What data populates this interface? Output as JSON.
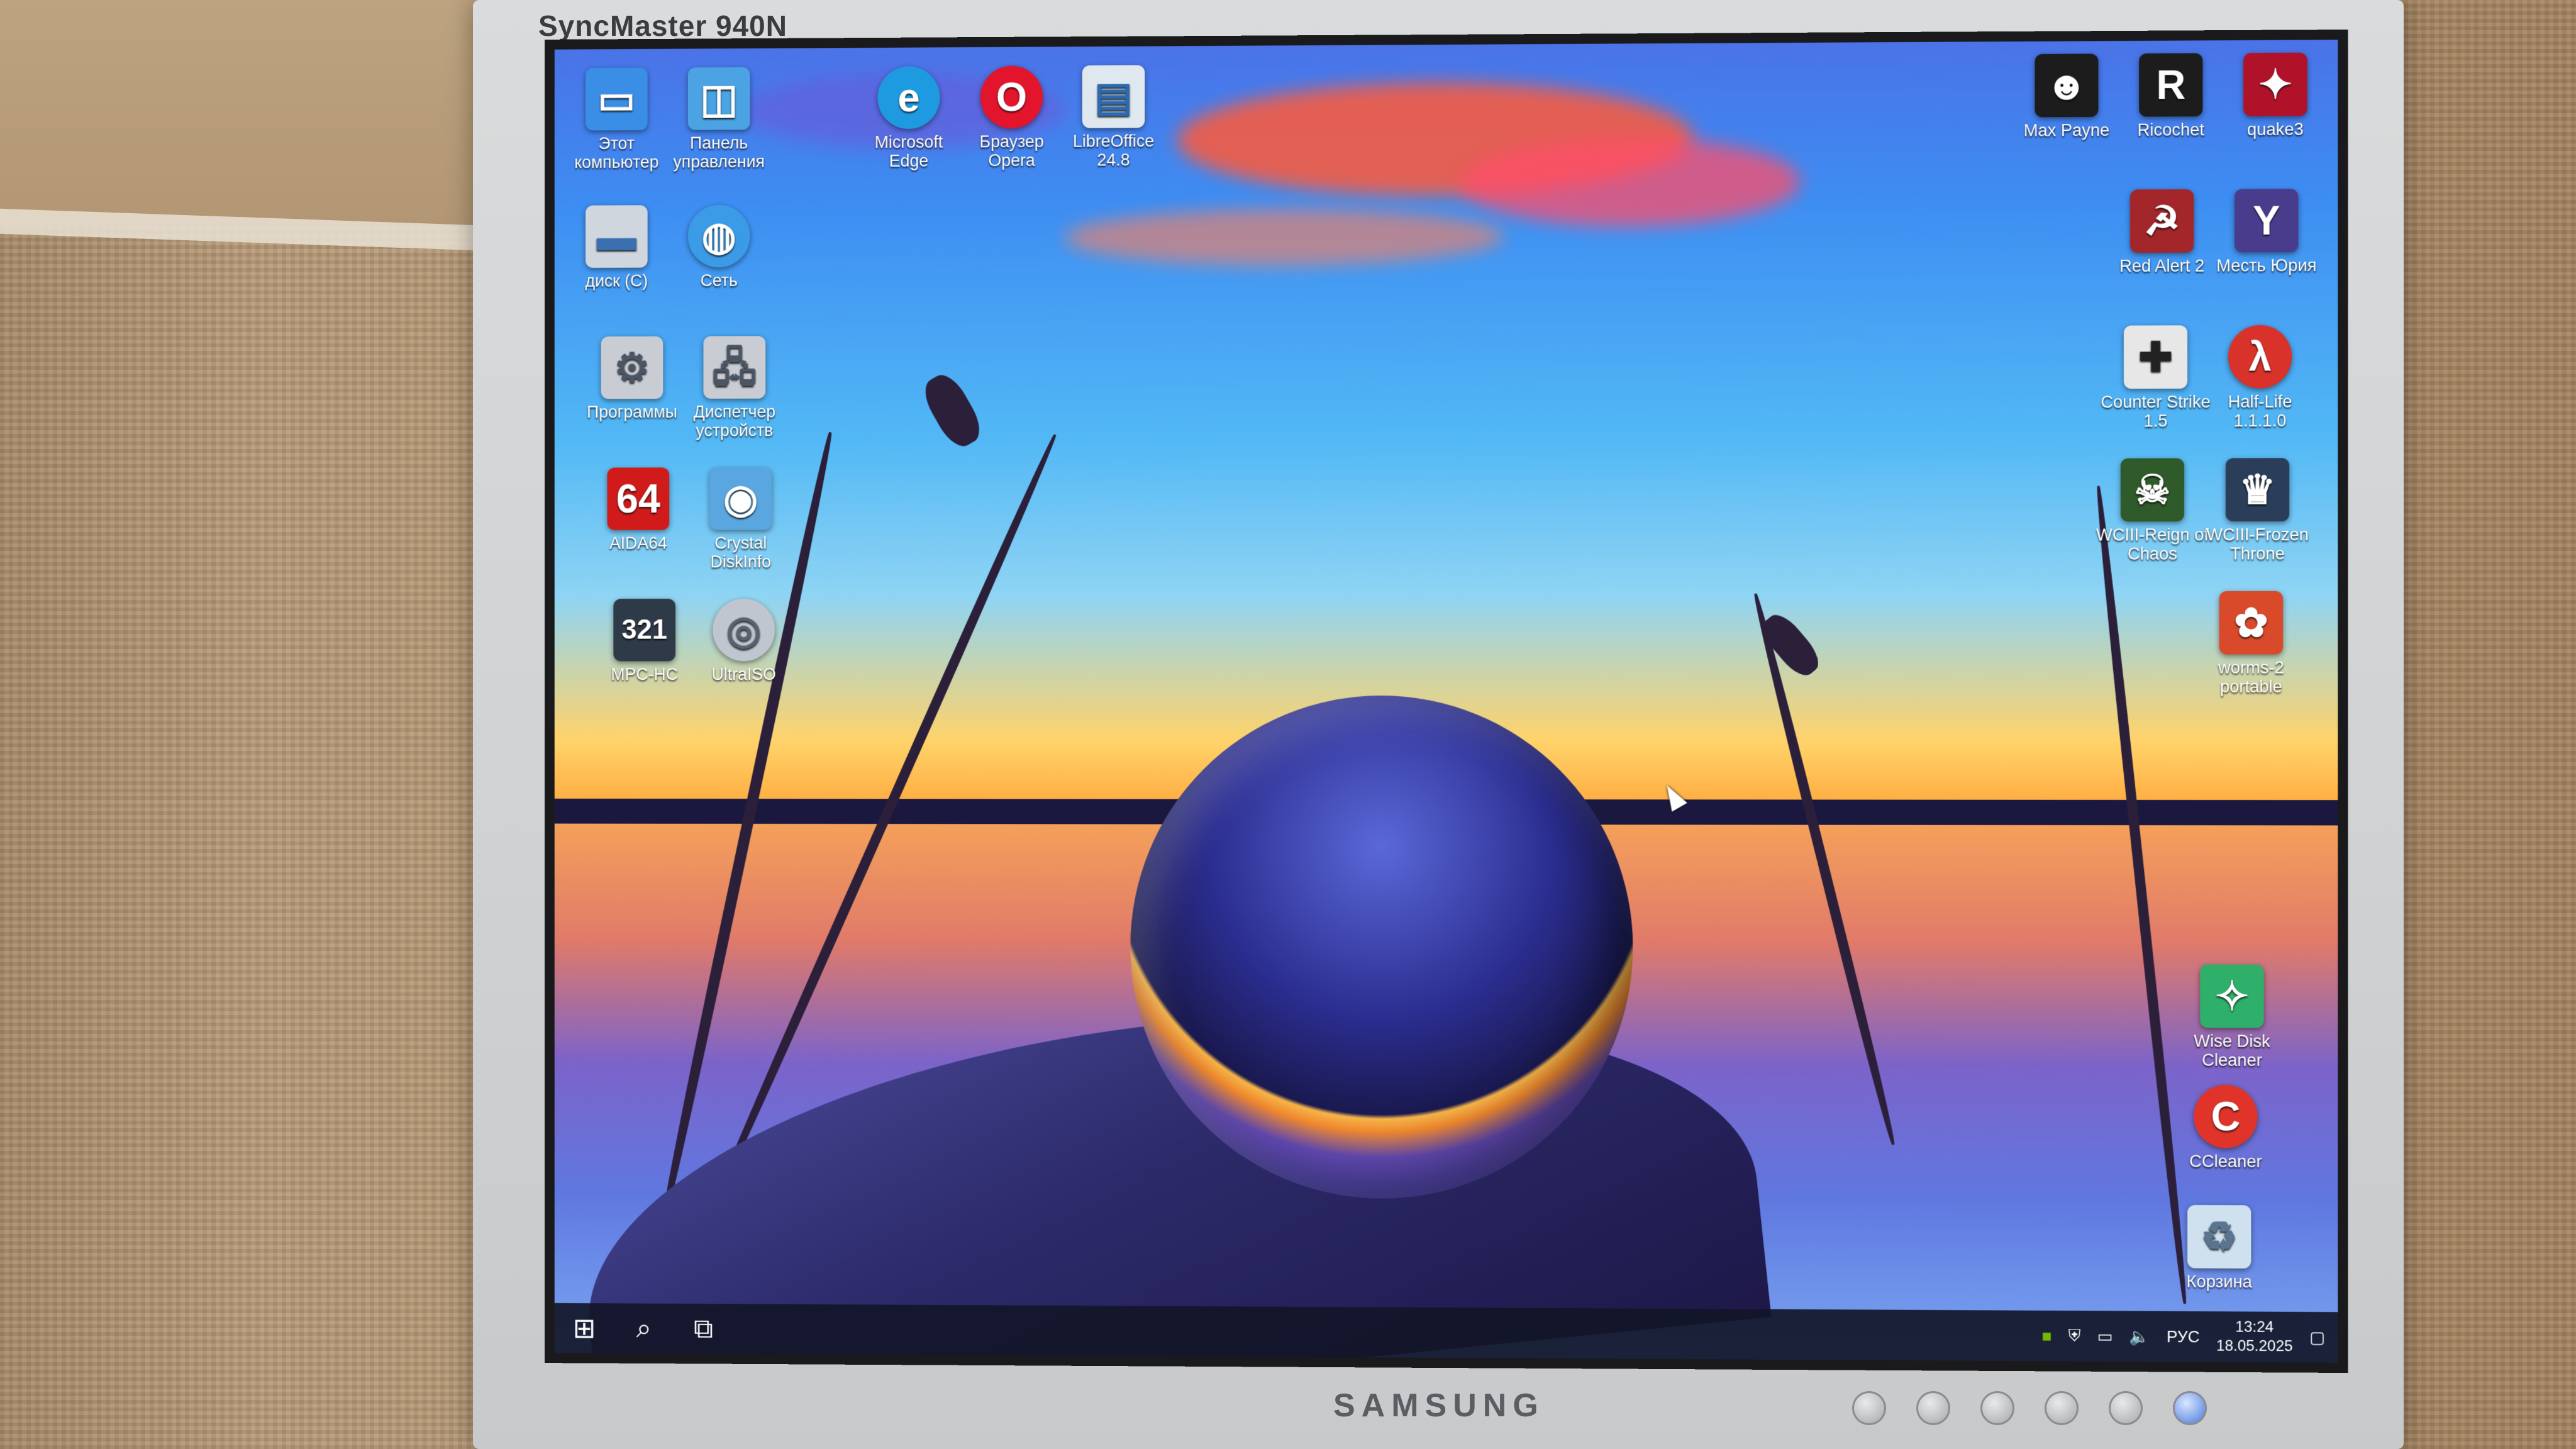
{
  "monitor": {
    "model": "SyncMaster 940N",
    "brand": "SAMSUNG"
  },
  "desktop": {
    "icons_left": [
      {
        "id": "this-pc",
        "label": "Этот компьютер",
        "icon": "computer-icon",
        "color": "#3a8ee6"
      },
      {
        "id": "control-panel",
        "label": "Панель управления",
        "icon": "control-panel-icon",
        "color": "#4ba3e3"
      },
      {
        "id": "edge",
        "label": "Microsoft Edge",
        "icon": "edge-icon",
        "color": "#1e9be0"
      },
      {
        "id": "opera",
        "label": "Браузер Opera",
        "icon": "opera-icon",
        "color": "#e3152c"
      },
      {
        "id": "libreoffice",
        "label": "LibreOffice 24.8",
        "icon": "libreoffice-icon",
        "color": "#dfe7ef"
      },
      {
        "id": "disk-c",
        "label": "диск (C)",
        "icon": "drive-icon",
        "color": "#cfd6de"
      },
      {
        "id": "network",
        "label": "Сеть",
        "icon": "network-icon",
        "color": "#3b9be6"
      },
      {
        "id": "programs",
        "label": "Программы",
        "icon": "programs-icon",
        "color": "#c9cdd3"
      },
      {
        "id": "device-manager",
        "label": "Диспетчер устройств",
        "icon": "device-manager-icon",
        "color": "#c9cdd3"
      },
      {
        "id": "aida64",
        "label": "AIDA64",
        "icon": "aida64-icon",
        "color": "#d11b1b"
      },
      {
        "id": "crystaldiskinfo",
        "label": "Crystal DiskInfo",
        "icon": "crystaldiskinfo-icon",
        "color": "#5aa6e0"
      },
      {
        "id": "mpc-hc",
        "label": "MPC-HC",
        "icon": "mpc-hc-icon",
        "color": "#2f3a48"
      },
      {
        "id": "ultraiso",
        "label": "UltraISO",
        "icon": "ultraiso-icon",
        "color": "#bfc6cf"
      }
    ],
    "icons_right": [
      {
        "id": "max-payne",
        "label": "Max Payne",
        "icon": "max-payne-icon",
        "color": "#1c1c1c"
      },
      {
        "id": "ricochet",
        "label": "Ricochet",
        "icon": "ricochet-icon",
        "color": "#1c1c1c"
      },
      {
        "id": "quake3",
        "label": "quake3",
        "icon": "quake3-icon",
        "color": "#b0122a"
      },
      {
        "id": "red-alert-2",
        "label": "Red Alert 2",
        "icon": "red-alert-2-icon",
        "color": "#a3262a"
      },
      {
        "id": "yuri-revenge",
        "label": "Месть Юрия",
        "icon": "yuri-revenge-icon",
        "color": "#4a3c8c"
      },
      {
        "id": "counter-strike",
        "label": "Counter Strike 1.5",
        "icon": "counter-strike-icon",
        "color": "#e7e7e7"
      },
      {
        "id": "half-life",
        "label": "Half-Life 1.1.1.0",
        "icon": "half-life-icon",
        "color": "#d8322a"
      },
      {
        "id": "wc3-roc",
        "label": "WCIII-Reign of Chaos",
        "icon": "warcraft3-roc-icon",
        "color": "#2f5a2a"
      },
      {
        "id": "wc3-tft",
        "label": "WCIII-Frozen Throne",
        "icon": "warcraft3-tft-icon",
        "color": "#2a3e5a"
      },
      {
        "id": "worms2",
        "label": "worms-2 portable",
        "icon": "worms2-icon",
        "color": "#d94a2a"
      },
      {
        "id": "wise-disk-cleaner",
        "label": "Wise Disk Cleaner",
        "icon": "wise-disk-cleaner-icon",
        "color": "#2fb06a"
      },
      {
        "id": "ccleaner",
        "label": "CCleaner",
        "icon": "ccleaner-icon",
        "color": "#e0342a"
      },
      {
        "id": "recycle-bin",
        "label": "Корзина",
        "icon": "recycle-bin-icon",
        "color": "#cfe0ee"
      }
    ]
  },
  "taskbar": {
    "start": "start-icon",
    "search": "search-icon",
    "task_view": "task-view-icon",
    "tray": {
      "language": "РУС",
      "time": "13:24",
      "date": "18.05.2025"
    }
  }
}
